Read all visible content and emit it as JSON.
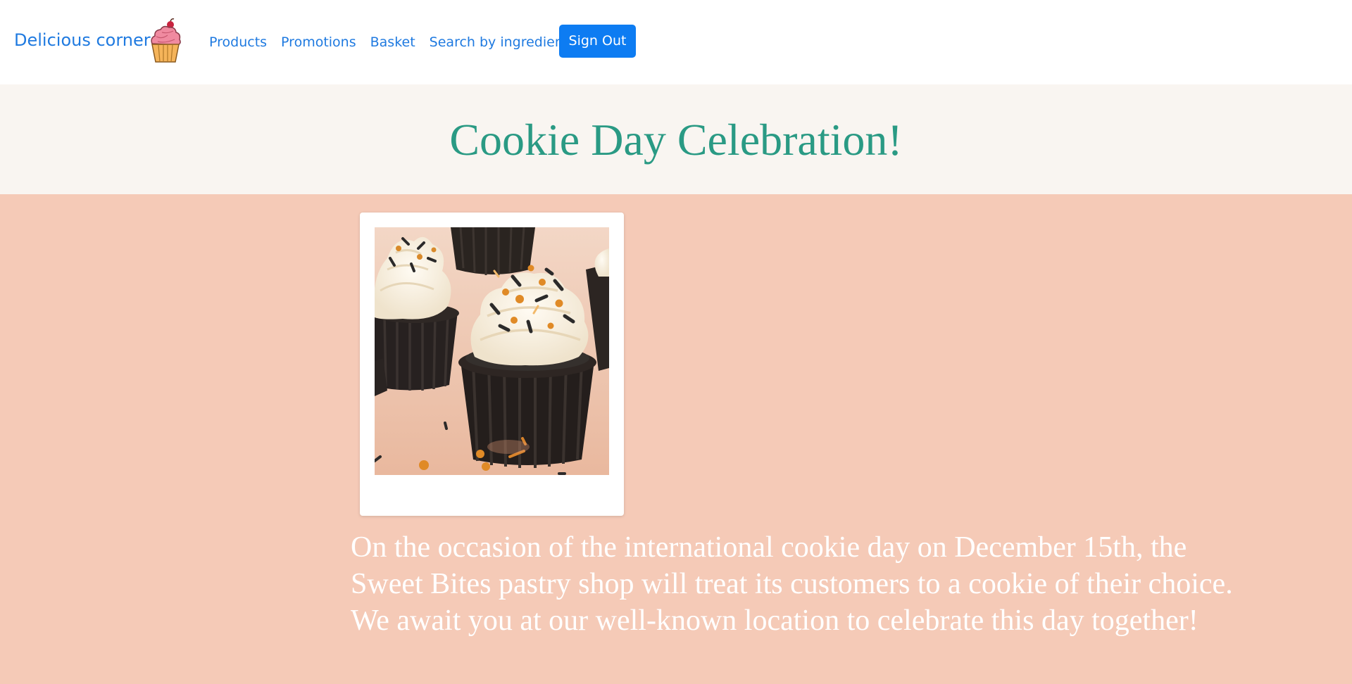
{
  "navbar": {
    "brand": "Delicious corner",
    "brand_logo_icon": "cupcake-logo-icon",
    "links": [
      "Products",
      "Promotions",
      "Basket",
      "Search by ingredients"
    ],
    "signout_label": "Sign Out"
  },
  "hero": {
    "title": "Cookie Day Celebration!"
  },
  "promotion": {
    "image_icon": "chocolate-cupcakes-photo",
    "description": "On the occasion of the international cookie day on December 15th, the Sweet Bites pastry shop will treat its customers to a cookie of their choice. We await you at our well-known location to celebrate this day together!"
  },
  "colors": {
    "brand": "#1f7ae0",
    "button": "#0d7cf2",
    "title": "#2a9a84",
    "hero_bg": "#f9f5f1",
    "content_bg": "#f5cab7"
  }
}
